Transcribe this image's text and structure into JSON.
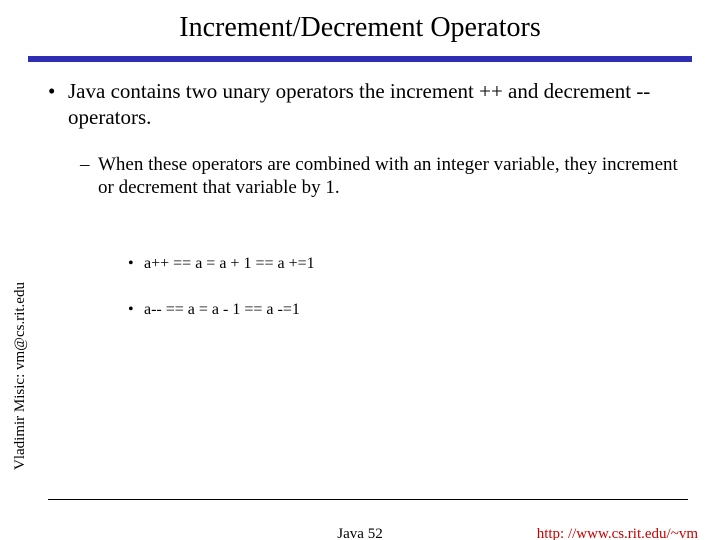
{
  "title": "Increment/Decrement Operators",
  "bullets": {
    "main": "Java contains two unary operators the increment ++ and decrement  -- operators.",
    "sub": "When these operators are combined with an integer variable, they increment or decrement that variable by 1.",
    "code1": "a++  ==   a = a + 1  ==   a +=1",
    "code2": "a--  ==   a = a - 1  ==   a -=1"
  },
  "side_label": "Vladimir Misic: vm@cs.rit.edu",
  "footer": {
    "center": "Java 52",
    "right": "http: //www.cs.rit.edu/~vm"
  },
  "glyphs": {
    "bullet": "•",
    "dash": "–"
  }
}
